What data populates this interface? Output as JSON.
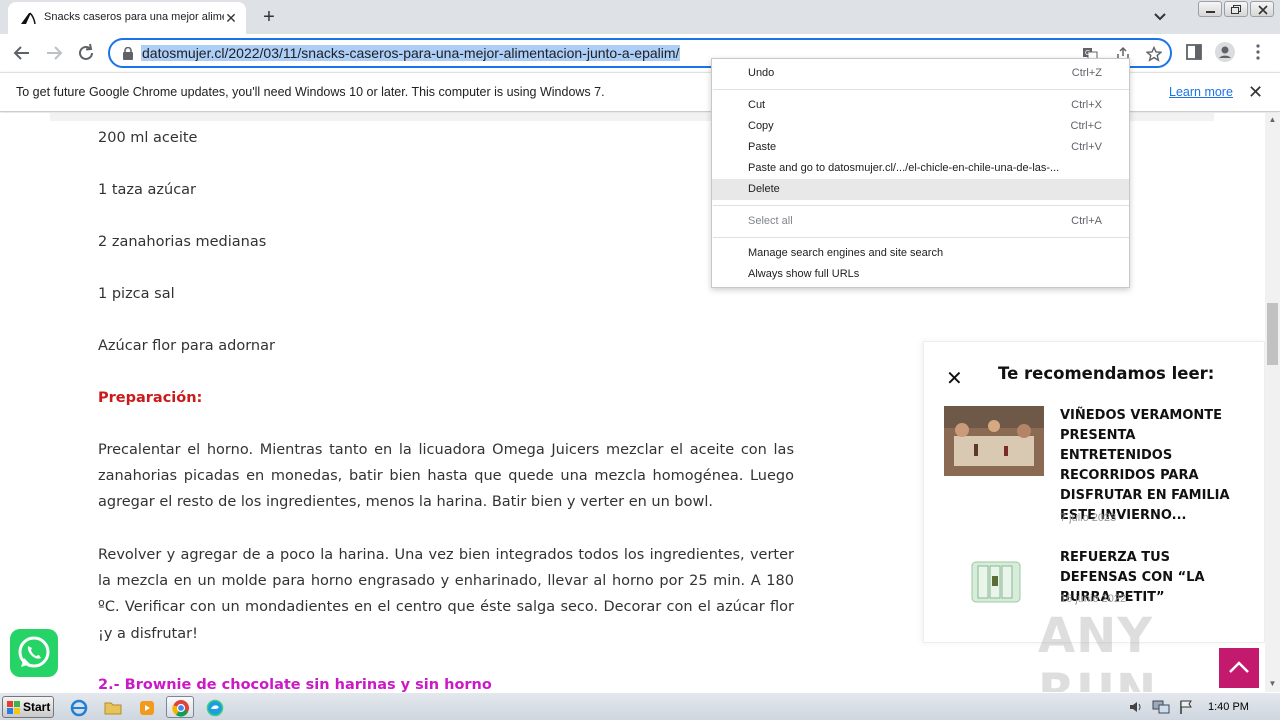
{
  "browser": {
    "tab_title": "Snacks caseros para una mejor alimentación junto a Epalim",
    "new_tab_symbol": "+",
    "tab_close_symbol": "✕",
    "url": "datosmujer.cl/2022/03/11/snacks-caseros-para-una-mejor-alimentacion-junto-a-epalim/"
  },
  "infobar": {
    "message": "To get future Google Chrome updates, you'll need Windows 10 or later. This computer is using Windows 7.",
    "link": "Learn more",
    "close_symbol": "✕"
  },
  "article": {
    "ingredients": [
      "200 ml aceite",
      "1 taza azúcar",
      "2 zanahorias medianas",
      "1 pizca sal",
      "Azúcar flor para adornar"
    ],
    "prep_heading": "Preparación:",
    "paragraph1": "Precalentar el horno. Mientras tanto en la licuadora Omega Juicers mezclar el aceite con las zanahorias picadas en monedas, batir bien hasta que quede una mezcla homogénea. Luego agregar el resto de los ingredientes, menos la harina. Batir bien y verter en un bowl.",
    "paragraph2": "Revolver y agregar de a poco la harina. Una vez bien integrados todos los ingredientes, verter la mezcla en un molde para horno engrasado y enharinado, llevar al horno por 25 min. A 180 ºC. Verificar con un mondadientes en el centro que éste salga seco. Decorar con el azúcar flor ¡y a disfrutar!",
    "next_heading": "2.- Brownie de chocolate sin harinas y sin horno"
  },
  "recommend": {
    "close_symbol": "✕",
    "title": "Te recomendamos leer:",
    "items": [
      {
        "headline": "VIÑEDOS VERAMONTE PRESENTA ENTRETENIDOS RECORRIDOS PARA DISFRUTAR EN FAMILIA ESTE INVIERNO...",
        "date": "7 julio 2023"
      },
      {
        "headline": "REFUERZA TUS DEFENSAS CON “LA BURRA PETIT”",
        "date": "16 junio 2022"
      }
    ]
  },
  "context_menu": {
    "items": [
      {
        "label": "Undo",
        "shortcut": "Ctrl+Z"
      },
      {
        "label": "Cut",
        "shortcut": "Ctrl+X"
      },
      {
        "label": "Copy",
        "shortcut": "Ctrl+C"
      },
      {
        "label": "Paste",
        "shortcut": "Ctrl+V"
      },
      {
        "label": "Paste and go to datosmujer.cl/.../el-chicle-en-chile-una-de-las-...",
        "shortcut": ""
      },
      {
        "label": "Delete",
        "shortcut": ""
      },
      {
        "label": "Select all",
        "shortcut": "Ctrl+A"
      },
      {
        "label": "Manage search engines and site search",
        "shortcut": ""
      },
      {
        "label": "Always show full URLs",
        "shortcut": ""
      }
    ]
  },
  "watermark": "ANY RUN",
  "taskbar": {
    "start_label": "Start",
    "clock": "1:40 PM"
  },
  "colors": {
    "accent": "#1a73e8",
    "heading_red": "#cc1a1a",
    "heading_magenta": "#cc19c6",
    "totop": "#c41a6e",
    "whatsapp": "#25d366"
  }
}
